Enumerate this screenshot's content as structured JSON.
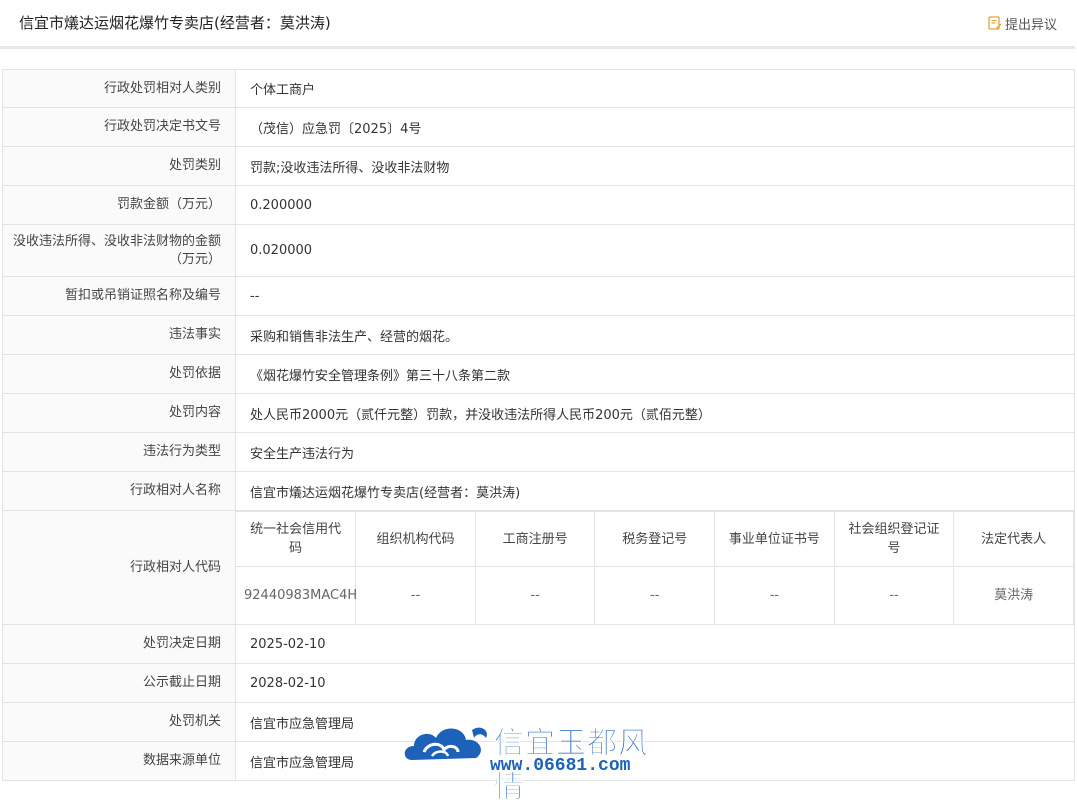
{
  "header": {
    "title": "信宜市燨达运烟花爆竹专卖店(经营者：莫洪涛)",
    "objection_label": "提出异议"
  },
  "rows": [
    {
      "label": "行政处罚相对人类别",
      "value": "个体工商户"
    },
    {
      "label": "行政处罚决定书文号",
      "value": "（茂信）应急罚〔2025〕4号"
    },
    {
      "label": "处罚类别",
      "value": "罚款;没收违法所得、没收非法财物"
    },
    {
      "label": "罚款金额（万元）",
      "value": "0.200000"
    },
    {
      "label": "没收违法所得、没收非法财物的金额（万元）",
      "value": "0.020000"
    },
    {
      "label": "暂扣或吊销证照名称及编号",
      "value": "--"
    },
    {
      "label": "违法事实",
      "value": "采购和销售非法生产、经营的烟花。"
    },
    {
      "label": "处罚依据",
      "value": "《烟花爆竹安全管理条例》第三十八条第二款"
    },
    {
      "label": "处罚内容",
      "value": "处人民币2000元（贰仟元整）罚款，并没收违法所得人民币200元（贰佰元整）"
    },
    {
      "label": "违法行为类型",
      "value": "安全生产违法行为"
    },
    {
      "label": "行政相对人名称",
      "value": "信宜市燨达运烟花爆竹专卖店(经营者：莫洪涛)"
    }
  ],
  "code_table": {
    "label": "行政相对人代码",
    "headers": [
      "统一社会信用代码",
      "组织机构代码",
      "工商注册号",
      "税务登记号",
      "事业单位证书号",
      "社会组织登记证号",
      "法定代表人"
    ],
    "values": [
      "92440983MAC4H",
      "--",
      "--",
      "--",
      "--",
      "--",
      "莫洪涛"
    ]
  },
  "rows2": [
    {
      "label": "处罚决定日期",
      "value": "2025-02-10"
    },
    {
      "label": "公示截止日期",
      "value": "2028-02-10"
    },
    {
      "label": "处罚机关",
      "value": "信宜市应急管理局"
    },
    {
      "label": "数据来源单位",
      "value": "信宜市应急管理局"
    }
  ],
  "watermark": {
    "title": "信宜玉都风情",
    "url": "www.06681.com"
  },
  "colors": {
    "watermark_blue": "#1d62b8",
    "objection_icon": "#e8a33a"
  }
}
